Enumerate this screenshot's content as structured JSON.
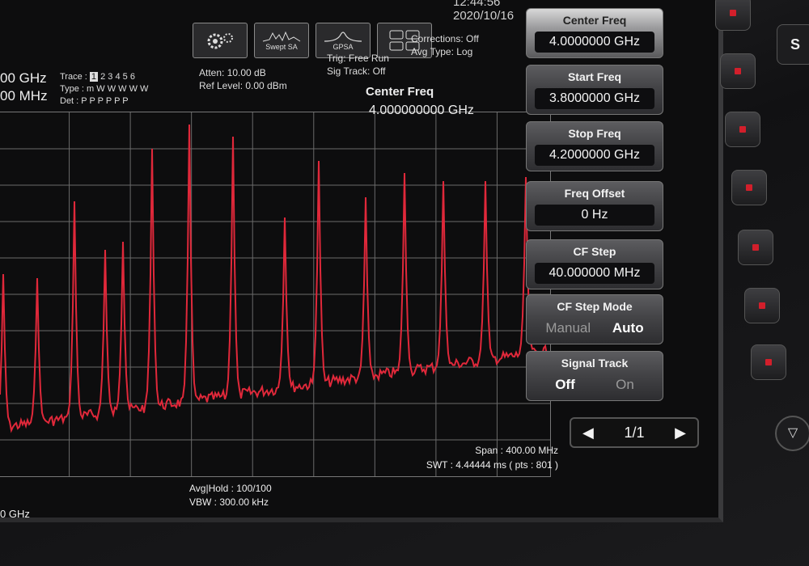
{
  "header": {
    "time": "12:44:56",
    "date": "2020/10/16"
  },
  "mode_buttons": [
    {
      "label": "",
      "icon": "gear-icon"
    },
    {
      "label": "Swept SA",
      "icon": "spectrum-icon"
    },
    {
      "label": "GPSA",
      "icon": "peak-icon"
    },
    {
      "label": "",
      "icon": "layout-icon"
    }
  ],
  "status": {
    "freq_line1": "00 GHz",
    "freq_line2": "00 MHz",
    "trace_label": "Trace :",
    "trace_numbers": [
      "1",
      "2",
      "3",
      "4",
      "5",
      "6"
    ],
    "type_label": "Type :",
    "type_values": "m W W W W W",
    "det_label": "Det :",
    "det_values": "P P P P P P",
    "atten": "Atten: 10.00 dB",
    "ref_level": "Ref Level: 0.00 dBm",
    "trig": "Trig: Free Run",
    "sig_track": "Sig Track: Off",
    "corrections": "Corrections: Off",
    "avg_type": "Avg Type: Log"
  },
  "plot": {
    "center_label": "Center Freq",
    "center_value": "4.000000000 GHz",
    "span": "Span : 400.00 MHz",
    "swt": "SWT : 4.44444 ms ( pts : 801 )",
    "avg_hold": "Avg|Hold : 100/100",
    "vbw": "VBW : 300.00 kHz",
    "start_partial": "0 GHz",
    "trace_color": "#e0283a"
  },
  "softkeys": [
    {
      "label": "Center Freq",
      "value": "4.0000000 GHz",
      "active": true
    },
    {
      "label": "Start Freq",
      "value": "3.8000000 GHz"
    },
    {
      "label": "Stop Freq",
      "value": "4.2000000 GHz"
    },
    {
      "label": "Freq Offset",
      "value": "0 Hz"
    },
    {
      "label": "CF Step",
      "value": "40.000000 MHz"
    },
    {
      "label": "CF Step Mode",
      "option_a": "Manual",
      "option_b": "Auto"
    },
    {
      "label": "Signal Track",
      "option_a": "Off",
      "option_b": "On"
    }
  ],
  "pager": {
    "prev": "◀",
    "page": "1/1",
    "next": "▶"
  },
  "hardware": {
    "round_button": "▽",
    "side_key": "S"
  }
}
